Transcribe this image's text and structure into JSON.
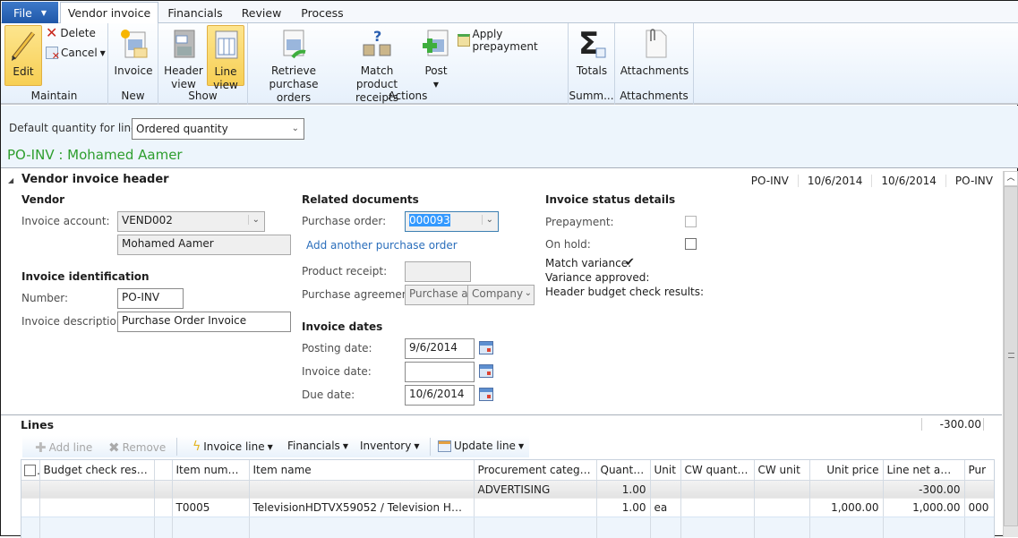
{
  "tabs": {
    "file": "File",
    "items": [
      {
        "label": "Vendor invoice",
        "active": true
      },
      {
        "label": "Financials",
        "active": false
      },
      {
        "label": "Review",
        "active": false
      },
      {
        "label": "Process",
        "active": false
      }
    ]
  },
  "ribbon": {
    "maintain": {
      "label": "Maintain",
      "edit": "Edit",
      "delete": "Delete",
      "cancel": "Cancel"
    },
    "new": {
      "label": "New",
      "invoice": "Invoice"
    },
    "show": {
      "label": "Show",
      "header_view_1": "Header",
      "header_view_2": "view",
      "line_view_1": "Line",
      "line_view_2": "view"
    },
    "actions": {
      "label": "Actions",
      "retrieve_1": "Retrieve",
      "retrieve_2": "purchase orders",
      "match_1": "Match product",
      "match_2": "receipts",
      "post": "Post",
      "apply_prepayment": "Apply prepayment"
    },
    "summary": {
      "label": "Summ...",
      "totals": "Totals"
    },
    "attachments": {
      "label": "Attachments",
      "attachments": "Attachments"
    }
  },
  "infobar": {
    "default_qty_label": "Default quantity for lines:",
    "default_qty_value": "Ordered quantity",
    "title": "PO-INV : Mohamed Aamer"
  },
  "header": {
    "title": "Vendor invoice header",
    "summary": [
      "PO-INV",
      "10/6/2014",
      "10/6/2014",
      "PO-INV"
    ],
    "vendor": {
      "title": "Vendor",
      "account_label": "Invoice account:",
      "account_value": "VEND002",
      "name_value": "Mohamed Aamer"
    },
    "identification": {
      "title": "Invoice identification",
      "number_label": "Number:",
      "number_value": "PO-INV",
      "desc_label": "Invoice description:",
      "desc_value": "Purchase Order Invoice"
    },
    "related": {
      "title": "Related documents",
      "po_label": "Purchase order:",
      "po_value": "000093",
      "add_po_link": "Add another purchase order",
      "receipt_label": "Product receipt:",
      "receipt_value": "",
      "agreement_label": "Purchase agreement:",
      "agreement_value": "Purchase a",
      "agreement_company": "Company"
    },
    "dates": {
      "title": "Invoice dates",
      "posting_label": "Posting date:",
      "posting_value": "9/6/2014",
      "invoice_label": "Invoice date:",
      "invoice_value": "",
      "due_label": "Due date:",
      "due_value": "10/6/2014"
    },
    "status": {
      "title": "Invoice status details",
      "prepayment_label": "Prepayment:",
      "prepayment_checked": false,
      "on_hold_label": "On hold:",
      "on_hold_checked": false,
      "match_variance_label": "Match variance:",
      "match_variance_mark": "✔",
      "variance_approved_label": "Variance approved:",
      "budget_label": "Header budget check results:"
    }
  },
  "lines": {
    "title": "Lines",
    "total": "-300.00",
    "toolbar": {
      "add_line": "Add line",
      "remove": "Remove",
      "invoice_line": "Invoice line",
      "financials": "Financials",
      "inventory": "Inventory",
      "update_line": "Update line"
    },
    "columns": [
      "Budget check results",
      "",
      "Item number",
      "Item name",
      "Procurement category",
      "Quantity",
      "Unit",
      "CW quantity",
      "CW unit",
      "Unit price",
      "Line net amount",
      "Pur"
    ],
    "rows": [
      [
        "",
        "",
        "",
        "",
        "ADVERTISING",
        "1.00",
        "",
        "",
        "",
        "",
        "-300.00",
        ""
      ],
      [
        "",
        "",
        "T0005",
        "TelevisionHDTVX59052 / Television HDTV X...",
        "",
        "1.00",
        "ea",
        "",
        "",
        "1,000.00",
        "1,000.00",
        "000"
      ],
      [
        "",
        "",
        "",
        "",
        "",
        "",
        "",
        "",
        "",
        "",
        "",
        ""
      ]
    ]
  }
}
